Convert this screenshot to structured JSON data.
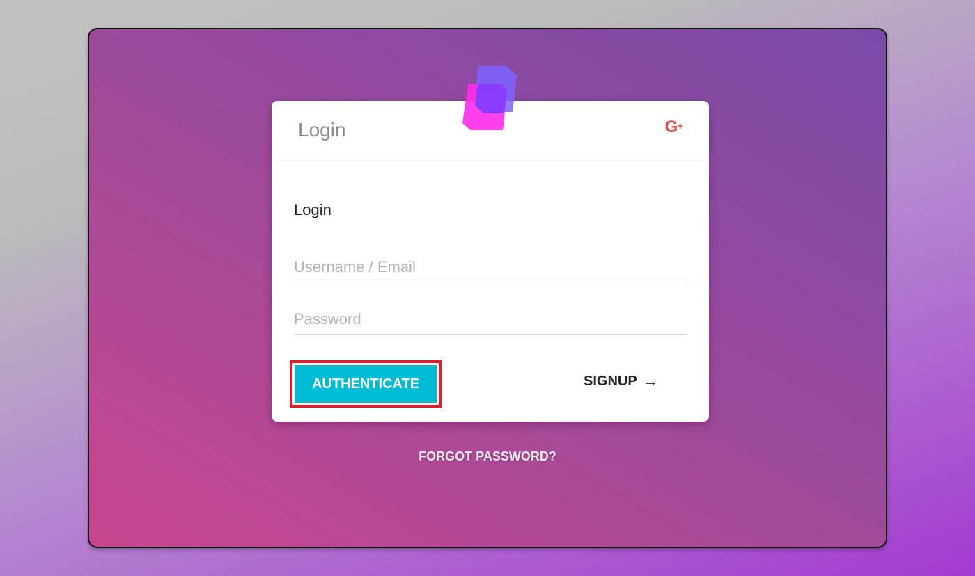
{
  "card": {
    "header_title": "Login",
    "social_icon": "google-plus-icon",
    "social_label": "G",
    "social_plus": "+",
    "logo_icon": "stacked-squares-logo-icon",
    "section_title": "Login"
  },
  "form": {
    "username_placeholder": "Username / Email",
    "password_placeholder": "Password",
    "username_value": "",
    "password_value": ""
  },
  "actions": {
    "authenticate_label": "AUTHENTICATE",
    "signup_label": "SIGNUP",
    "signup_arrow": "→",
    "forgot_label": "FORGOT PASSWORD?"
  },
  "colors": {
    "accent": "#00bcd4",
    "highlight_border": "#e0202e",
    "google": "#e2504c",
    "logo_magenta": "#ff2bea",
    "logo_violet": "#7b63ff"
  }
}
